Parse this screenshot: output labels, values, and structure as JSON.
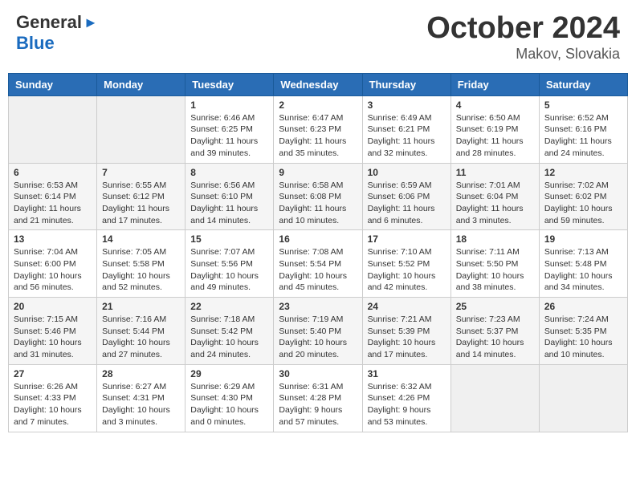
{
  "header": {
    "logo_general": "General",
    "logo_blue": "Blue",
    "month": "October 2024",
    "location": "Makov, Slovakia"
  },
  "weekdays": [
    "Sunday",
    "Monday",
    "Tuesday",
    "Wednesday",
    "Thursday",
    "Friday",
    "Saturday"
  ],
  "weeks": [
    [
      {
        "day": "",
        "sunrise": "",
        "sunset": "",
        "daylight": ""
      },
      {
        "day": "",
        "sunrise": "",
        "sunset": "",
        "daylight": ""
      },
      {
        "day": "1",
        "sunrise": "Sunrise: 6:46 AM",
        "sunset": "Sunset: 6:25 PM",
        "daylight": "Daylight: 11 hours and 39 minutes."
      },
      {
        "day": "2",
        "sunrise": "Sunrise: 6:47 AM",
        "sunset": "Sunset: 6:23 PM",
        "daylight": "Daylight: 11 hours and 35 minutes."
      },
      {
        "day": "3",
        "sunrise": "Sunrise: 6:49 AM",
        "sunset": "Sunset: 6:21 PM",
        "daylight": "Daylight: 11 hours and 32 minutes."
      },
      {
        "day": "4",
        "sunrise": "Sunrise: 6:50 AM",
        "sunset": "Sunset: 6:19 PM",
        "daylight": "Daylight: 11 hours and 28 minutes."
      },
      {
        "day": "5",
        "sunrise": "Sunrise: 6:52 AM",
        "sunset": "Sunset: 6:16 PM",
        "daylight": "Daylight: 11 hours and 24 minutes."
      }
    ],
    [
      {
        "day": "6",
        "sunrise": "Sunrise: 6:53 AM",
        "sunset": "Sunset: 6:14 PM",
        "daylight": "Daylight: 11 hours and 21 minutes."
      },
      {
        "day": "7",
        "sunrise": "Sunrise: 6:55 AM",
        "sunset": "Sunset: 6:12 PM",
        "daylight": "Daylight: 11 hours and 17 minutes."
      },
      {
        "day": "8",
        "sunrise": "Sunrise: 6:56 AM",
        "sunset": "Sunset: 6:10 PM",
        "daylight": "Daylight: 11 hours and 14 minutes."
      },
      {
        "day": "9",
        "sunrise": "Sunrise: 6:58 AM",
        "sunset": "Sunset: 6:08 PM",
        "daylight": "Daylight: 11 hours and 10 minutes."
      },
      {
        "day": "10",
        "sunrise": "Sunrise: 6:59 AM",
        "sunset": "Sunset: 6:06 PM",
        "daylight": "Daylight: 11 hours and 6 minutes."
      },
      {
        "day": "11",
        "sunrise": "Sunrise: 7:01 AM",
        "sunset": "Sunset: 6:04 PM",
        "daylight": "Daylight: 11 hours and 3 minutes."
      },
      {
        "day": "12",
        "sunrise": "Sunrise: 7:02 AM",
        "sunset": "Sunset: 6:02 PM",
        "daylight": "Daylight: 10 hours and 59 minutes."
      }
    ],
    [
      {
        "day": "13",
        "sunrise": "Sunrise: 7:04 AM",
        "sunset": "Sunset: 6:00 PM",
        "daylight": "Daylight: 10 hours and 56 minutes."
      },
      {
        "day": "14",
        "sunrise": "Sunrise: 7:05 AM",
        "sunset": "Sunset: 5:58 PM",
        "daylight": "Daylight: 10 hours and 52 minutes."
      },
      {
        "day": "15",
        "sunrise": "Sunrise: 7:07 AM",
        "sunset": "Sunset: 5:56 PM",
        "daylight": "Daylight: 10 hours and 49 minutes."
      },
      {
        "day": "16",
        "sunrise": "Sunrise: 7:08 AM",
        "sunset": "Sunset: 5:54 PM",
        "daylight": "Daylight: 10 hours and 45 minutes."
      },
      {
        "day": "17",
        "sunrise": "Sunrise: 7:10 AM",
        "sunset": "Sunset: 5:52 PM",
        "daylight": "Daylight: 10 hours and 42 minutes."
      },
      {
        "day": "18",
        "sunrise": "Sunrise: 7:11 AM",
        "sunset": "Sunset: 5:50 PM",
        "daylight": "Daylight: 10 hours and 38 minutes."
      },
      {
        "day": "19",
        "sunrise": "Sunrise: 7:13 AM",
        "sunset": "Sunset: 5:48 PM",
        "daylight": "Daylight: 10 hours and 34 minutes."
      }
    ],
    [
      {
        "day": "20",
        "sunrise": "Sunrise: 7:15 AM",
        "sunset": "Sunset: 5:46 PM",
        "daylight": "Daylight: 10 hours and 31 minutes."
      },
      {
        "day": "21",
        "sunrise": "Sunrise: 7:16 AM",
        "sunset": "Sunset: 5:44 PM",
        "daylight": "Daylight: 10 hours and 27 minutes."
      },
      {
        "day": "22",
        "sunrise": "Sunrise: 7:18 AM",
        "sunset": "Sunset: 5:42 PM",
        "daylight": "Daylight: 10 hours and 24 minutes."
      },
      {
        "day": "23",
        "sunrise": "Sunrise: 7:19 AM",
        "sunset": "Sunset: 5:40 PM",
        "daylight": "Daylight: 10 hours and 20 minutes."
      },
      {
        "day": "24",
        "sunrise": "Sunrise: 7:21 AM",
        "sunset": "Sunset: 5:39 PM",
        "daylight": "Daylight: 10 hours and 17 minutes."
      },
      {
        "day": "25",
        "sunrise": "Sunrise: 7:23 AM",
        "sunset": "Sunset: 5:37 PM",
        "daylight": "Daylight: 10 hours and 14 minutes."
      },
      {
        "day": "26",
        "sunrise": "Sunrise: 7:24 AM",
        "sunset": "Sunset: 5:35 PM",
        "daylight": "Daylight: 10 hours and 10 minutes."
      }
    ],
    [
      {
        "day": "27",
        "sunrise": "Sunrise: 6:26 AM",
        "sunset": "Sunset: 4:33 PM",
        "daylight": "Daylight: 10 hours and 7 minutes."
      },
      {
        "day": "28",
        "sunrise": "Sunrise: 6:27 AM",
        "sunset": "Sunset: 4:31 PM",
        "daylight": "Daylight: 10 hours and 3 minutes."
      },
      {
        "day": "29",
        "sunrise": "Sunrise: 6:29 AM",
        "sunset": "Sunset: 4:30 PM",
        "daylight": "Daylight: 10 hours and 0 minutes."
      },
      {
        "day": "30",
        "sunrise": "Sunrise: 6:31 AM",
        "sunset": "Sunset: 4:28 PM",
        "daylight": "Daylight: 9 hours and 57 minutes."
      },
      {
        "day": "31",
        "sunrise": "Sunrise: 6:32 AM",
        "sunset": "Sunset: 4:26 PM",
        "daylight": "Daylight: 9 hours and 53 minutes."
      },
      {
        "day": "",
        "sunrise": "",
        "sunset": "",
        "daylight": ""
      },
      {
        "day": "",
        "sunrise": "",
        "sunset": "",
        "daylight": ""
      }
    ]
  ]
}
